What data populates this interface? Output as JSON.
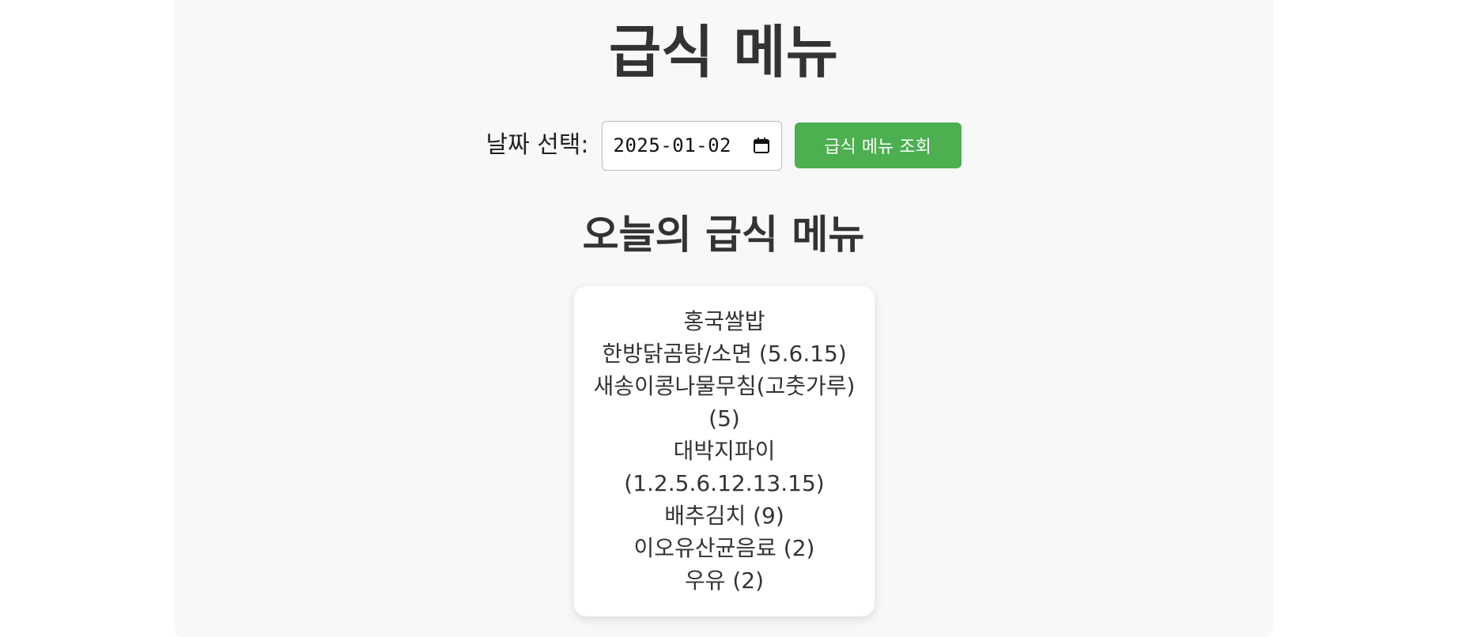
{
  "page": {
    "title": "급식 메뉴"
  },
  "controls": {
    "date_label": "날짜 선택:",
    "date_value": "2025-01-02",
    "calendar_icon": "calendar-icon",
    "lookup_button_label": "급식 메뉴 조회",
    "accent_color": "#4caf50"
  },
  "menu": {
    "heading": "오늘의 급식 메뉴",
    "items": [
      "홍국쌀밥",
      "한방닭곰탕/소면 (5.6.15)",
      "새송이콩나물무침(고춧가루) (5)",
      "대박지파이 (1.2.5.6.12.13.15)",
      "배추김치 (9)",
      "이오유산균음료 (2)",
      "우유 (2)"
    ]
  }
}
